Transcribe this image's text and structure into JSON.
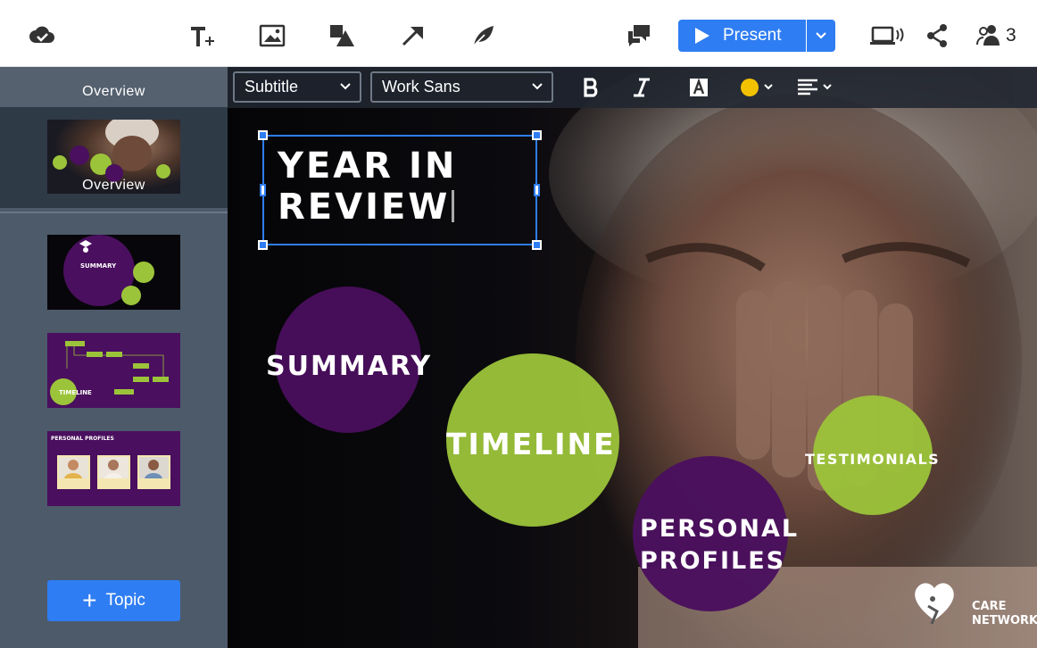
{
  "toolbar": {
    "icons": [
      "cloud-saved-icon",
      "add-text-icon",
      "add-image-icon",
      "add-shape-icon",
      "add-arrow-icon",
      "add-symbol-icon",
      "comments-icon",
      "present-icon",
      "presenter-view-icon",
      "share-icon",
      "collaborators-icon"
    ],
    "present_label": "Present",
    "collaborator_count": "3",
    "accent_color": "#2f7df2"
  },
  "sidebar": {
    "header": "Overview",
    "overview_thumb_label": "Overview",
    "slides": [
      {
        "label": "SUMMARY"
      },
      {
        "label": "TIMELINE"
      },
      {
        "label": "PERSONAL PROFILES"
      }
    ],
    "add_topic_label": "Topic"
  },
  "format_bar": {
    "style_select": "Subtitle",
    "font_select": "Work Sans",
    "text_color": "#f2c200"
  },
  "canvas": {
    "title_line1": "YEAR IN",
    "title_line2": "REVIEW",
    "topics": {
      "summary": "SUMMARY",
      "timeline": "TIMELINE",
      "personal_profiles_line1": "PERSONAL",
      "personal_profiles_line2": "PROFILES",
      "testimonials": "TESTIMONIALS"
    },
    "brand_line1": "CARE",
    "brand_line2": "NETWORK",
    "colors": {
      "purple": "#4a0f5e",
      "green": "#9cc43a"
    }
  }
}
